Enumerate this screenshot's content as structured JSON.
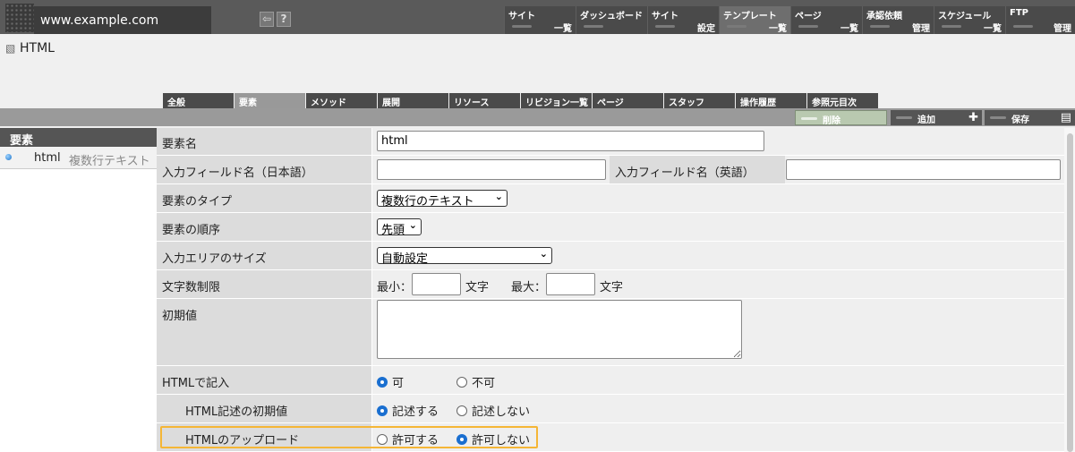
{
  "browser": {
    "url": "www.example.com"
  },
  "topnav": [
    {
      "line1": "サイト",
      "line2": "一覧"
    },
    {
      "line1": "ダッシュボード",
      "line2": ""
    },
    {
      "line1": "サイト",
      "line2": "設定"
    },
    {
      "line1": "テンプレート",
      "line2": "一覧"
    },
    {
      "line1": "ページ",
      "line2": "一覧"
    },
    {
      "line1": "承認依頼",
      "line2": "管理"
    },
    {
      "line1": "スケジュール",
      "line2": "一覧"
    },
    {
      "line1": "FTP",
      "line2": "管理"
    }
  ],
  "page": {
    "title": "HTML"
  },
  "tabs": [
    "全般",
    "要素",
    "メソッド",
    "展開",
    "リソース",
    "リビジョン一覧",
    "ページ",
    "スタッフ",
    "操作履歴",
    "参照元目次"
  ],
  "toolbar": {
    "delete": "削除",
    "add": "追加",
    "save": "保存"
  },
  "sidebar": {
    "header": "要素",
    "item_name": "html",
    "item_type": "複数行テキスト"
  },
  "form": {
    "element_name": {
      "label": "要素名",
      "value": "html"
    },
    "field_name_ja": {
      "label": "入力フィールド名（日本語）",
      "value": ""
    },
    "field_name_en": {
      "label": "入力フィールド名（英語）",
      "value": ""
    },
    "element_type": {
      "label": "要素のタイプ",
      "value": "複数行のテキスト"
    },
    "element_order": {
      "label": "要素の順序",
      "value": "先頭"
    },
    "area_size": {
      "label": "入力エリアのサイズ",
      "value": "自動設定"
    },
    "char_limit": {
      "label": "文字数制限",
      "min_label": "最小：",
      "max_label": "最大：",
      "unit": "文字",
      "min_value": "",
      "max_value": ""
    },
    "initial_value": {
      "label": "初期値",
      "value": ""
    },
    "html_input": {
      "label": "HTMLで記入",
      "opt_yes": "可",
      "opt_no": "不可",
      "selected": "yes"
    },
    "html_initial": {
      "label": "HTML記述の初期値",
      "opt_yes": "記述する",
      "opt_no": "記述しない",
      "selected": "yes"
    },
    "html_upload": {
      "label": "HTMLのアップロード",
      "opt_yes": "許可する",
      "opt_no": "許可しない",
      "selected": "no"
    }
  }
}
